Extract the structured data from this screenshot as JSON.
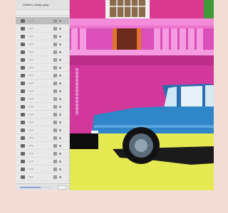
{
  "file": {
    "name": "Untitled_design.jpeg"
  },
  "layers": [
    {
      "label": "Layer"
    },
    {
      "label": "Layer"
    },
    {
      "label": "Layer"
    },
    {
      "label": "Layer"
    },
    {
      "label": "Layer"
    },
    {
      "label": "Layer"
    },
    {
      "label": "Layer"
    },
    {
      "label": "Layer"
    },
    {
      "label": "Layer"
    },
    {
      "label": "Layer"
    },
    {
      "label": "Layer"
    },
    {
      "label": "Layer"
    },
    {
      "label": "Layer"
    },
    {
      "label": "Layer"
    },
    {
      "label": "Layer"
    },
    {
      "label": "Layer"
    },
    {
      "label": "Layer"
    },
    {
      "label": "Layer"
    },
    {
      "label": "Layer"
    },
    {
      "label": "Layer"
    },
    {
      "label": "Layer"
    }
  ],
  "selected_layer": 0,
  "progress": 0.65,
  "colors": {
    "wall_magenta": "#d2379b",
    "balcony_pink": "#ec74cf",
    "car_blue": "#2f86c8",
    "road_yellow": "#e6ea52",
    "background": "#f4dcd6"
  },
  "icons": [
    "layer-thumbnail-icon",
    "layer-visibility-icon",
    "layer-lock-icon"
  ]
}
